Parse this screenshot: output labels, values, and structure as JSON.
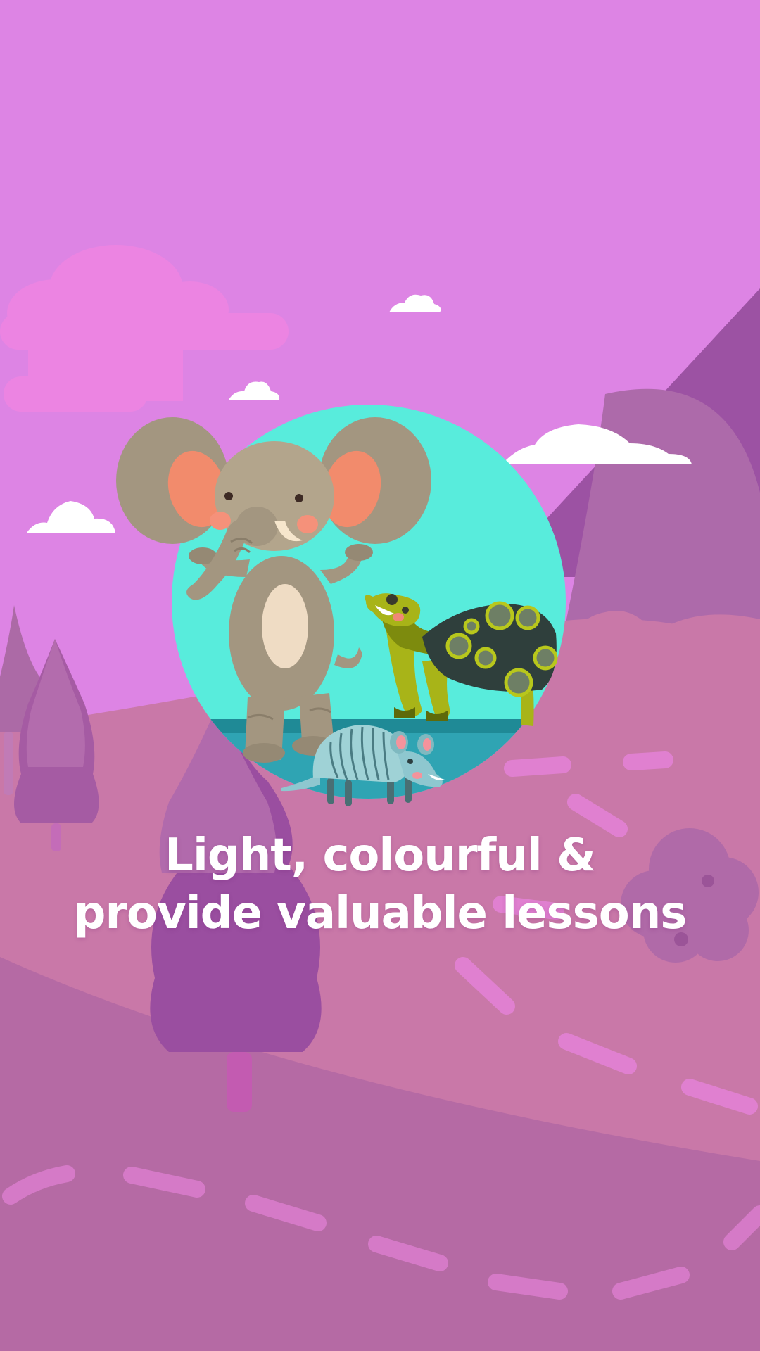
{
  "onboarding": {
    "caption_line_1": "Light, colourful &",
    "caption_line_2": "provide valuable lessons"
  },
  "illustration": {
    "subjects": [
      "elephant-icon",
      "turtle-icon",
      "armadillo-icon"
    ],
    "decorations": [
      "cloud-icon",
      "tree-icon",
      "mountain-icon",
      "flower-icon"
    ]
  },
  "colors": {
    "sky": "#dd84e4",
    "hill_light": "#c978a8",
    "hill_dark": "#b56aa4",
    "mountain": "#9c52a3",
    "tree": "#9a4ea0",
    "circle_bg": "#58ecdc",
    "water": "#2fa4b3",
    "caption": "#ffffff"
  }
}
